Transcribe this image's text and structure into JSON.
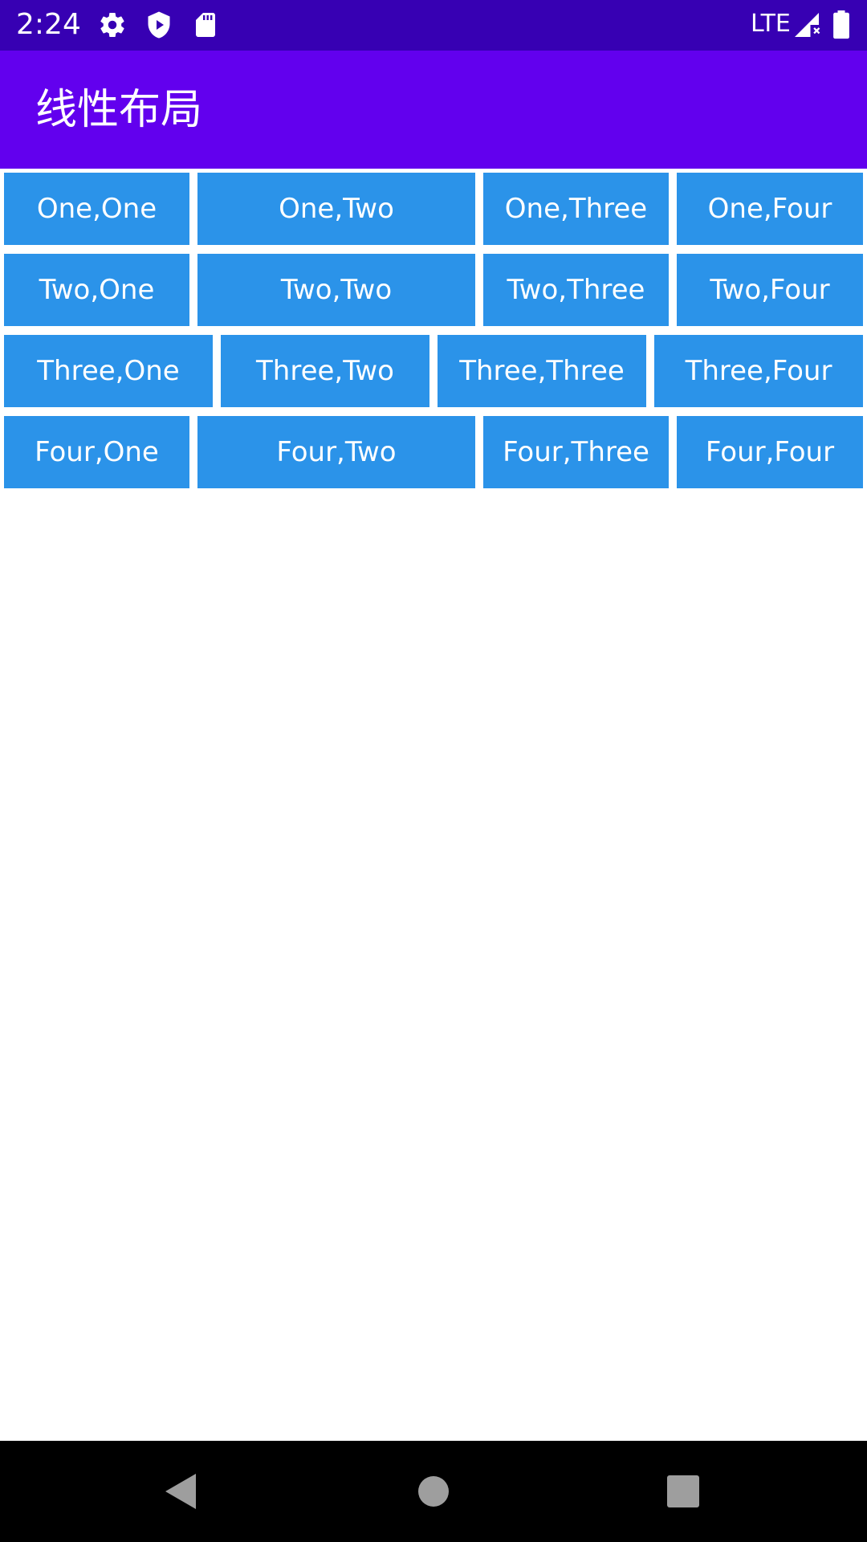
{
  "status_bar": {
    "time": "2:24",
    "network": "LTE",
    "icons": [
      "gear-icon",
      "play-protect-icon",
      "sd-card-icon",
      "signal-icon",
      "battery-icon"
    ],
    "bg_color": "#3700B3"
  },
  "app_bar": {
    "title": "线性布局",
    "bg_color": "#6200EE"
  },
  "grid": {
    "cell_color": "#2B93E9",
    "rows": [
      [
        "One,One",
        "One,Two",
        "One,Three",
        "One,Four"
      ],
      [
        "Two,One",
        "Two,Two",
        "Two,Three",
        "Two,Four"
      ],
      [
        "Three,One",
        "Three,Two",
        "Three,Three",
        "Three,Four"
      ],
      [
        "Four,One",
        "Four,Two",
        "Four,Three",
        "Four,Four"
      ]
    ]
  },
  "nav_bar": {
    "buttons": [
      "back-icon",
      "home-icon",
      "recents-icon"
    ]
  }
}
